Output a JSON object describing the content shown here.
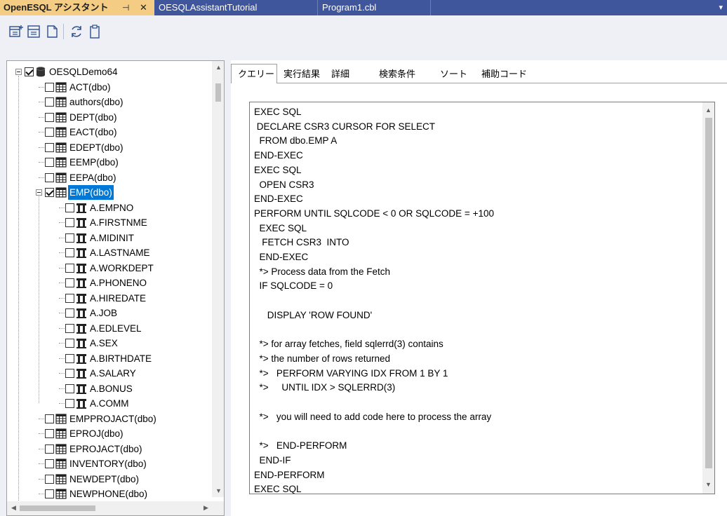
{
  "doc_tabs": [
    {
      "label": "OpenESQL アシスタント",
      "pin": "⊣",
      "close": "✕"
    },
    {
      "label": "OESQLAssistantTutorial"
    },
    {
      "label": "Program1.cbl"
    }
  ],
  "toolbar": {
    "buttons": [
      "add-query-icon",
      "add-query-alt-icon",
      "page-icon",
      "refresh-icon",
      "clipboard-icon"
    ]
  },
  "tree": {
    "root": "OESQLDemo64",
    "tables_before": [
      "ACT(dbo)",
      "authors(dbo)",
      "DEPT(dbo)",
      "EACT(dbo)",
      "EDEPT(dbo)",
      "EEMP(dbo)",
      "EEPA(dbo)"
    ],
    "selected_table": "EMP(dbo)",
    "columns": [
      "A.EMPNO",
      "A.FIRSTNME",
      "A.MIDINIT",
      "A.LASTNAME",
      "A.WORKDEPT",
      "A.PHONENO",
      "A.HIREDATE",
      "A.JOB",
      "A.EDLEVEL",
      "A.SEX",
      "A.BIRTHDATE",
      "A.SALARY",
      "A.BONUS",
      "A.COMM"
    ],
    "tables_after": [
      "EMPPROJACT(dbo)",
      "EPROJ(dbo)",
      "EPROJACT(dbo)",
      "INVENTORY(dbo)",
      "NEWDEPT(dbo)",
      "NEWPHONE(dbo)"
    ]
  },
  "tabs": [
    "クエリー",
    "実行結果",
    "詳細",
    "検索条件",
    "ソート",
    "補助コード"
  ],
  "code_lines": [
    "EXEC SQL",
    " DECLARE CSR3 CURSOR FOR SELECT",
    "  FROM dbo.EMP A",
    "END-EXEC",
    "EXEC SQL",
    "  OPEN CSR3",
    "END-EXEC",
    "PERFORM UNTIL SQLCODE < 0 OR SQLCODE = +100",
    "  EXEC SQL",
    "   FETCH CSR3  INTO",
    "  END-EXEC",
    "  *> Process data from the Fetch",
    "  IF SQLCODE = 0",
    "",
    "     DISPLAY 'ROW FOUND'",
    "",
    "  *> for array fetches, field sqlerrd(3) contains",
    "  *> the number of rows returned",
    "  *>   PERFORM VARYING IDX FROM 1 BY 1",
    "  *>     UNTIL IDX > SQLERRD(3)",
    "",
    "  *>   you will need to add code here to process the array",
    "",
    "  *>   END-PERFORM",
    "  END-IF",
    "END-PERFORM",
    "EXEC SQL"
  ],
  "colors": {
    "tab_bar": "#40569c",
    "active_tab": "#f5cc84",
    "selection": "#0078d7"
  }
}
